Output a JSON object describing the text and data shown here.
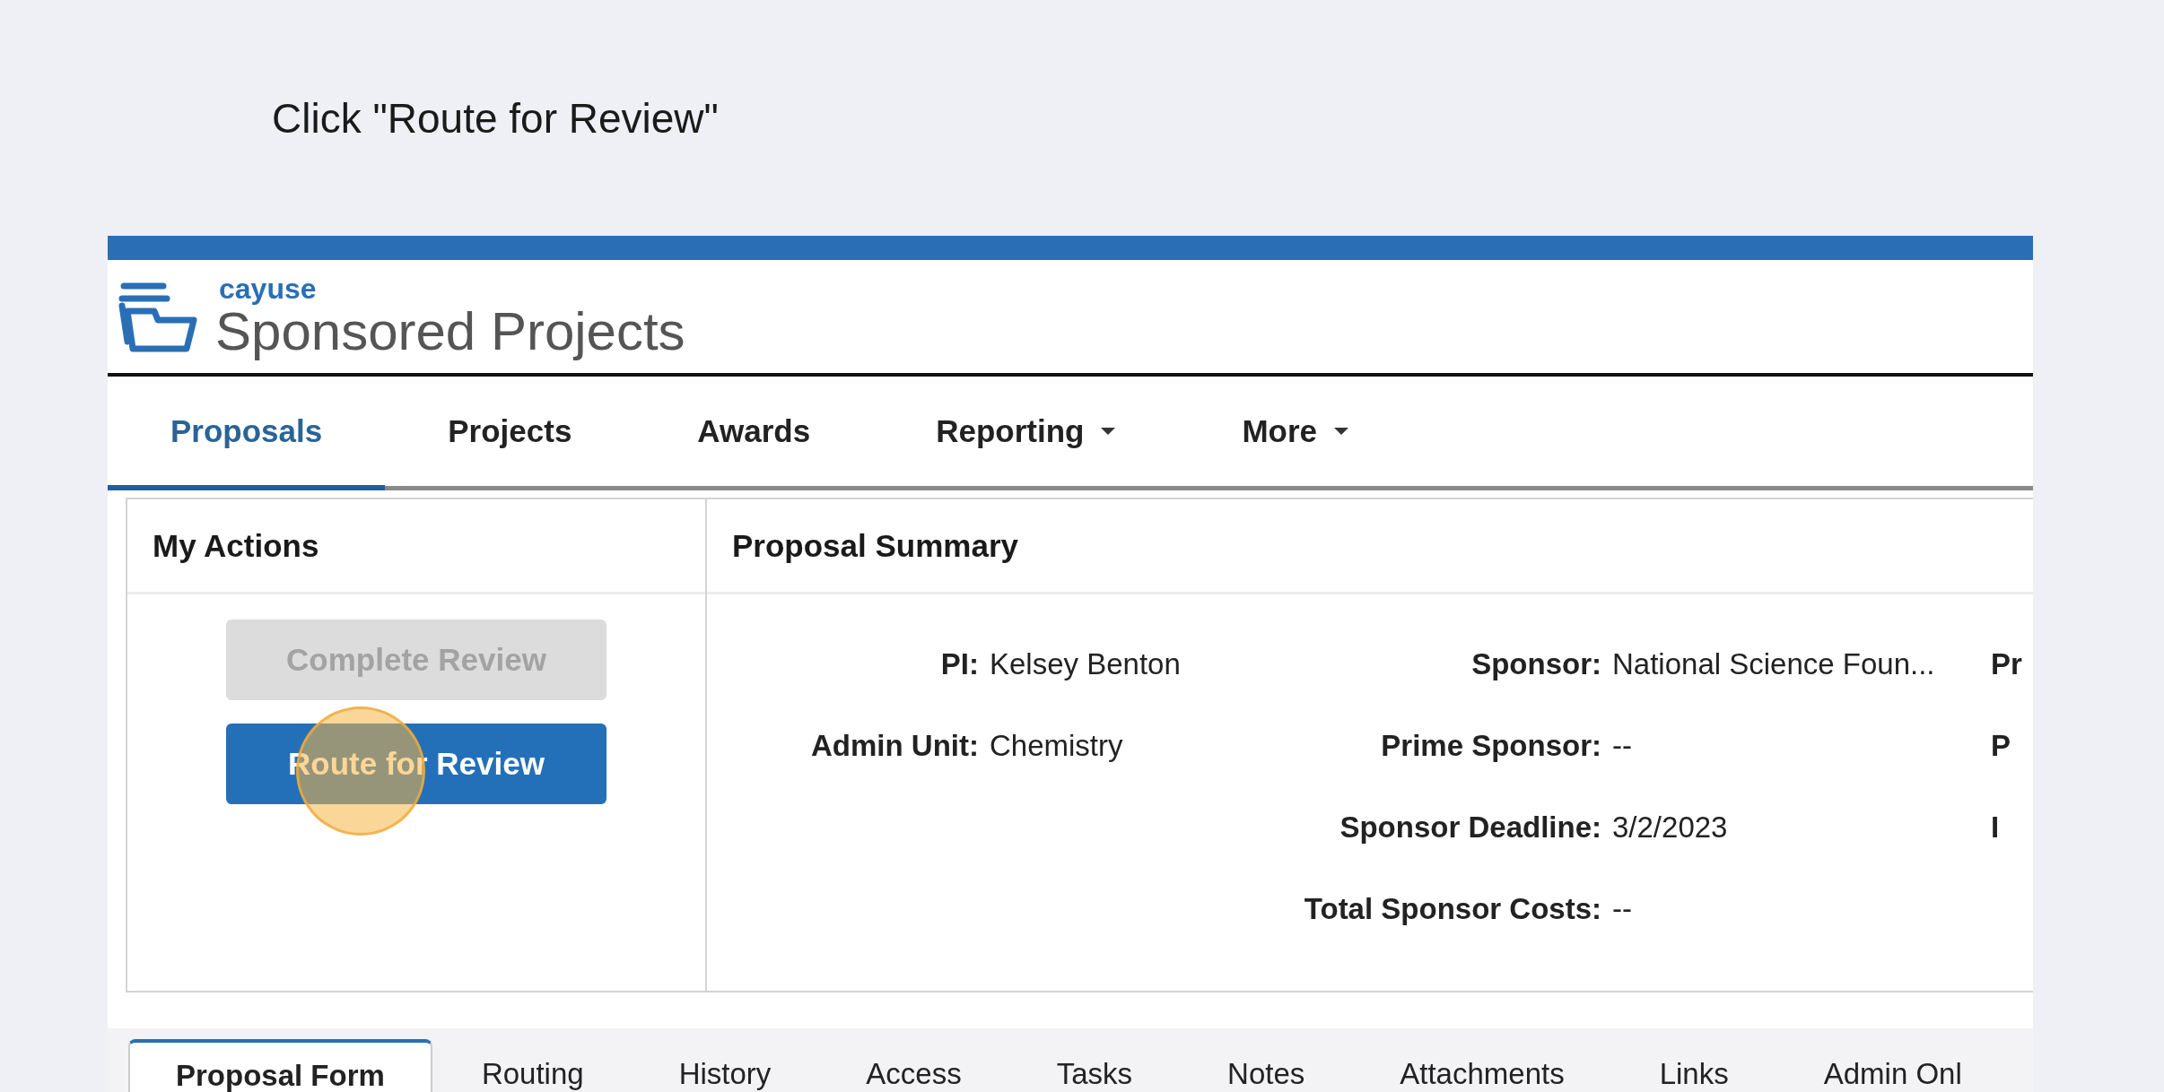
{
  "instruction": "Click \"Route for Review\"",
  "app": {
    "brand": "cayuse",
    "product": "Sponsored Projects"
  },
  "nav": [
    {
      "label": "Proposals",
      "selected": true,
      "kind": "link"
    },
    {
      "label": "Projects",
      "selected": false,
      "kind": "link"
    },
    {
      "label": "Awards",
      "selected": false,
      "kind": "link"
    },
    {
      "label": "Reporting",
      "selected": false,
      "kind": "dropdown"
    },
    {
      "label": "More",
      "selected": false,
      "kind": "dropdown"
    }
  ],
  "my_actions": {
    "title": "My Actions",
    "buttons": [
      {
        "label": "Complete Review",
        "disabled": true,
        "highlighted": false
      },
      {
        "label": "Route for Review",
        "disabled": false,
        "highlighted": true
      }
    ]
  },
  "summary": {
    "title": "Proposal Summary",
    "rows": [
      {
        "column_1": {
          "label": "PI:",
          "value": "Kelsey Benton"
        },
        "column_2": {
          "label": "Sponsor:",
          "value": "National Science Foun..."
        },
        "column_3": {
          "label": "Pr"
        }
      },
      {
        "column_1": {
          "label": "Admin Unit:",
          "value": "Chemistry"
        },
        "column_2": {
          "label": "Prime Sponsor:",
          "value": "--"
        },
        "column_3": {
          "label": "P"
        }
      },
      {
        "column_2": {
          "label": "Sponsor Deadline:",
          "value": "3/2/2023"
        },
        "column_3": {
          "label": "I"
        }
      },
      {
        "column_2": {
          "label": "Total Sponsor Costs:",
          "value": "--"
        }
      }
    ]
  },
  "tabs": [
    {
      "label": "Proposal Form",
      "selected": true
    },
    {
      "label": "Routing",
      "selected": false
    },
    {
      "label": "History",
      "selected": false
    },
    {
      "label": "Access",
      "selected": false
    },
    {
      "label": "Tasks",
      "selected": false
    },
    {
      "label": "Notes",
      "selected": false
    },
    {
      "label": "Attachments",
      "selected": false
    },
    {
      "label": "Links",
      "selected": false
    },
    {
      "label": "Admin Onl",
      "selected": false
    }
  ]
}
